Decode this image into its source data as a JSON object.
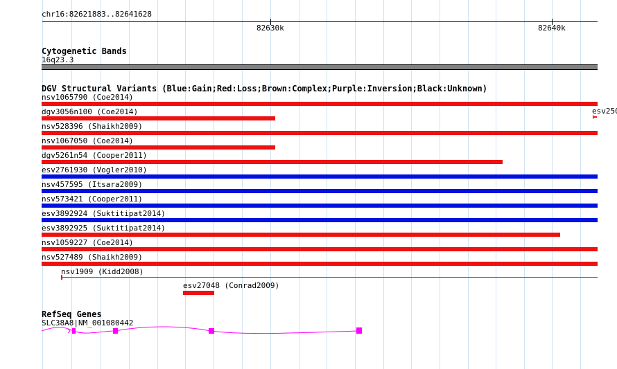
{
  "colors": {
    "gain": "#0010e0",
    "loss": "#ee1111",
    "gene": "#ff00ff",
    "gridline": "#cfe3f1",
    "band": "#808080"
  },
  "ruler": {
    "region_label": "chr16:82621883..82641628",
    "tick_labels": [
      "82630k",
      "82640k"
    ]
  },
  "cytoband": {
    "title": "Cytogenetic Bands",
    "band_label": "16q23.3"
  },
  "variants": {
    "title": "DGV Structural Variants (Blue:Gain;Red:Loss;Brown:Complex;Purple:Inversion;Black:Unknown)",
    "edge_label": "esv250",
    "items": [
      {
        "label": "nsv1065790 (Coe2014)",
        "type": "loss"
      },
      {
        "label": "dgv3056n100 (Coe2014)",
        "type": "loss"
      },
      {
        "label": "nsv528396 (Shaikh2009)",
        "type": "loss"
      },
      {
        "label": "nsv1067050 (Coe2014)",
        "type": "loss"
      },
      {
        "label": "dgv5261n54 (Cooper2011)",
        "type": "loss"
      },
      {
        "label": "esv2761930 (Vogler2010)",
        "type": "gain"
      },
      {
        "label": "nsv457595 (Itsara2009)",
        "type": "gain"
      },
      {
        "label": "nsv573421 (Cooper2011)",
        "type": "gain"
      },
      {
        "label": "esv3892924 (Suktitipat2014)",
        "type": "gain"
      },
      {
        "label": "esv3892925 (Suktitipat2014)",
        "type": "loss"
      },
      {
        "label": "nsv1059227 (Coe2014)",
        "type": "loss"
      },
      {
        "label": "nsv527489 (Shaikh2009)",
        "type": "loss"
      },
      {
        "label": "nsv1909 (Kidd2008)",
        "type": "loss"
      },
      {
        "label": "esv27048 (Conrad2009)",
        "type": "loss"
      }
    ]
  },
  "genes": {
    "title": "RefSeq Genes",
    "gene_label": "SLC38A8|NM_001080442"
  }
}
